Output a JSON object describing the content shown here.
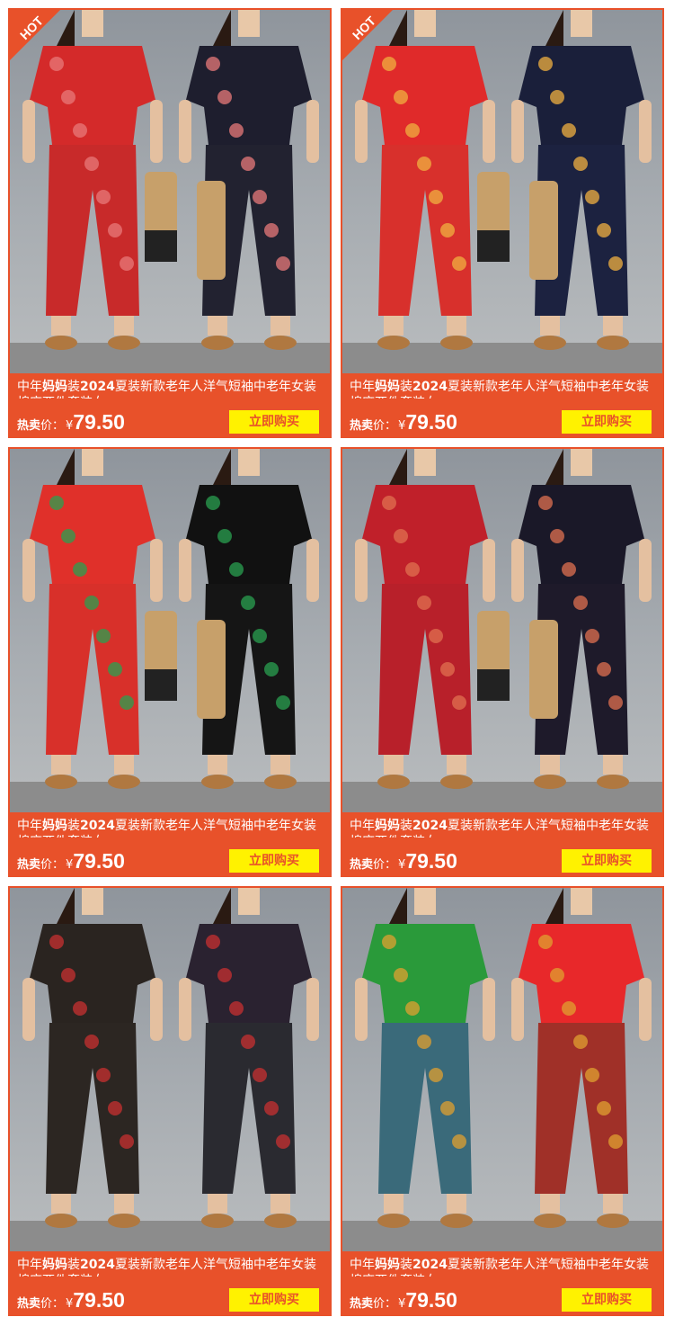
{
  "products": [
    {
      "hot": "HOT",
      "title_prefix": "中年",
      "title_bold": "妈妈",
      "title_mid": "装",
      "title_bold2": "2024",
      "title_suffix": "夏装新款老年人洋气短袖中老年女装棉麻两件套装女",
      "price_label": "热卖",
      "price_label2": "价：",
      "currency": "¥",
      "price": "79.50",
      "buy_label": "立即购买",
      "colors": {
        "left_top": "#d42a2a",
        "left_bottom": "#c82a2a",
        "right_top": "#1e1e2e",
        "right_bottom": "#222230",
        "accent": "#e87a7a",
        "bag": "#c7a06a"
      }
    },
    {
      "hot": "HOT",
      "title_prefix": "中年",
      "title_bold": "妈妈",
      "title_mid": "装",
      "title_bold2": "2024",
      "title_suffix": "夏装新款老年人洋气短袖中老年女装棉麻两件套装女",
      "price_label": "热卖",
      "price_label2": "价：",
      "currency": "¥",
      "price": "79.50",
      "buy_label": "立即购买",
      "colors": {
        "left_top": "#e02a2a",
        "left_bottom": "#d8302c",
        "right_top": "#1a1f3a",
        "right_bottom": "#1c2240",
        "accent": "#f0b040",
        "bag": "#c7a06a"
      }
    },
    {
      "hot": "",
      "title_prefix": "中年",
      "title_bold": "妈妈",
      "title_mid": "装",
      "title_bold2": "2024",
      "title_suffix": "夏装新款老年人洋气短袖中老年女装棉麻两件套装女",
      "price_label": "热卖",
      "price_label2": "价：",
      "currency": "¥",
      "price": "79.50",
      "buy_label": "立即购买",
      "colors": {
        "left_top": "#e0302a",
        "left_bottom": "#d8302a",
        "right_top": "#111111",
        "right_bottom": "#151515",
        "accent": "#2aa050",
        "bag": "#c7a06a"
      }
    },
    {
      "hot": "",
      "title_prefix": "中年",
      "title_bold": "妈妈",
      "title_mid": "装",
      "title_bold2": "2024",
      "title_suffix": "夏装新款老年人洋气短袖中老年女装棉麻两件套装女",
      "price_label": "热卖",
      "price_label2": "价：",
      "currency": "¥",
      "price": "79.50",
      "buy_label": "立即购买",
      "colors": {
        "left_top": "#c0202a",
        "left_bottom": "#b8202a",
        "right_top": "#1a1828",
        "right_bottom": "#1e1a2a",
        "accent": "#e07050",
        "bag": "#c7a06a"
      }
    },
    {
      "hot": "",
      "title_prefix": "中年",
      "title_bold": "妈妈",
      "title_mid": "装",
      "title_bold2": "2024",
      "title_suffix": "夏装新款老年人洋气短袖中老年女装棉麻两件套装女",
      "price_label": "热卖",
      "price_label2": "价：",
      "currency": "¥",
      "price": "79.50",
      "buy_label": "立即购买",
      "colors": {
        "left_top": "#2a2420",
        "left_bottom": "#2c2622",
        "right_top": "#2a2230",
        "right_bottom": "#2a2a30",
        "accent": "#c83030",
        "bag": ""
      }
    },
    {
      "hot": "",
      "title_prefix": "中年",
      "title_bold": "妈妈",
      "title_mid": "装",
      "title_bold2": "2024",
      "title_suffix": "夏装新款老年人洋气短袖中老年女装棉麻两件套装女",
      "price_label": "热卖",
      "price_label2": "价：",
      "currency": "¥",
      "price": "79.50",
      "buy_label": "立即购买",
      "colors": {
        "left_top": "#2a9a3a",
        "left_bottom": "#3a6a7a",
        "right_top": "#e8282a",
        "right_bottom": "#a03028",
        "accent": "#e0a030",
        "bag": ""
      }
    }
  ]
}
